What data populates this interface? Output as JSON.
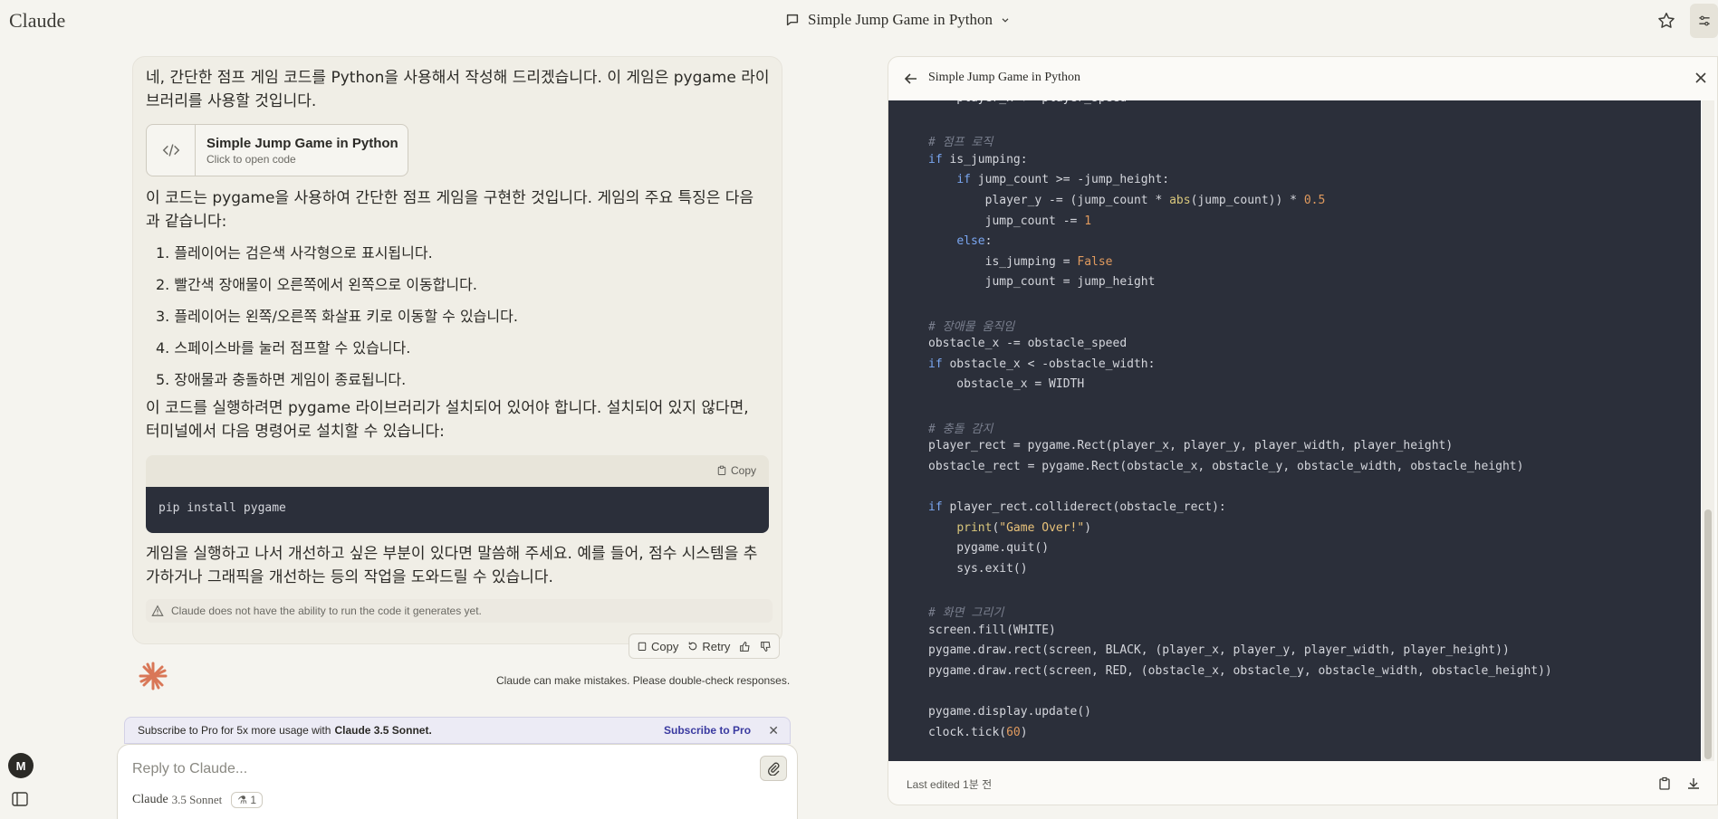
{
  "app": {
    "brand": "Claude",
    "conversation_title": "Simple Jump Game in Python"
  },
  "message": {
    "intro": "네, 간단한 점프 게임 코드를 Python을 사용해서 작성해 드리겠습니다. 이 게임은 pygame 라이\n브러리를 사용할 것입니다.",
    "artifact_title": "Simple Jump Game in Python",
    "artifact_sub": "Click to open code",
    "desc": "이 코드는 pygame을 사용하여 간단한 점프 게임을 구현한 것입니다. 게임의 주요 특징은 다음\n과 같습니다:",
    "features": [
      "플레이어는 검은색 사각형으로 표시됩니다.",
      "빨간색 장애물이 오른쪽에서 왼쪽으로 이동합니다.",
      "플레이어는 왼쪽/오른쪽 화살표 키로 이동할 수 있습니다.",
      "스페이스바를 눌러 점프할 수 있습니다.",
      "장애물과 충돌하면 게임이 종료됩니다."
    ],
    "install_note": "이 코드를 실행하려면 pygame 라이브러리가 설치되어 있어야 합니다. 설치되어 있지 않다면,\n터미널에서 다음 명령어로 설치할 수 있습니다:",
    "copy_label": "Copy",
    "install_cmd": "pip install pygame",
    "outro": "게임을 실행하고 나서 개선하고 싶은 부분이 있다면 말씀해 주세요. 예를 들어, 점수 시스템을 추\n가하거나 그래픽을 개선하는 등의 작업을 도와드릴 수 있습니다.",
    "warning": "Claude does not have the ability to run the code it generates yet."
  },
  "actions": {
    "copy": "Copy",
    "retry": "Retry"
  },
  "disclaimer": "Claude can make mistakes. Please double-check responses.",
  "promo": {
    "text": "Subscribe to Pro for 5x more usage with",
    "model": "Claude 3.5 Sonnet.",
    "cta": "Subscribe to Pro"
  },
  "reply": {
    "placeholder": "Reply to Claude...",
    "model_name": "Claude",
    "model_version": "3.5 Sonnet",
    "badge_count": "1"
  },
  "user": {
    "initial": "M"
  },
  "panel": {
    "title": "Simple Jump Game in Python",
    "last_edited": "Last edited 1분 전"
  },
  "code_lines": [
    "    player_x += player_speed",
    "",
    "# 점프 로직",
    "if is_jumping:",
    "    if jump_count >= -jump_height:",
    "        player_y -= (jump_count * abs(jump_count)) * 0.5",
    "        jump_count -= 1",
    "    else:",
    "        is_jumping = False",
    "        jump_count = jump_height",
    "",
    "# 장애물 움직임",
    "obstacle_x -= obstacle_speed",
    "if obstacle_x < -obstacle_width:",
    "    obstacle_x = WIDTH",
    "",
    "# 충돌 감지",
    "player_rect = pygame.Rect(player_x, player_y, player_width, player_height)",
    "obstacle_rect = pygame.Rect(obstacle_x, obstacle_y, obstacle_width, obstacle_height)",
    "",
    "if player_rect.colliderect(obstacle_rect):",
    "    print(\"Game Over!\")",
    "    pygame.quit()",
    "    sys.exit()",
    "",
    "# 화면 그리기",
    "screen.fill(WHITE)",
    "pygame.draw.rect(screen, BLACK, (player_x, player_y, player_width, player_height))",
    "pygame.draw.rect(screen, RED, (obstacle_x, obstacle_y, obstacle_width, obstacle_height))",
    "",
    "pygame.display.update()",
    "clock.tick(60)"
  ],
  "colors": {
    "accent_orange": "#d97757",
    "code_bg": "#2b2f3a",
    "promo_cta": "#3a3aa0"
  }
}
